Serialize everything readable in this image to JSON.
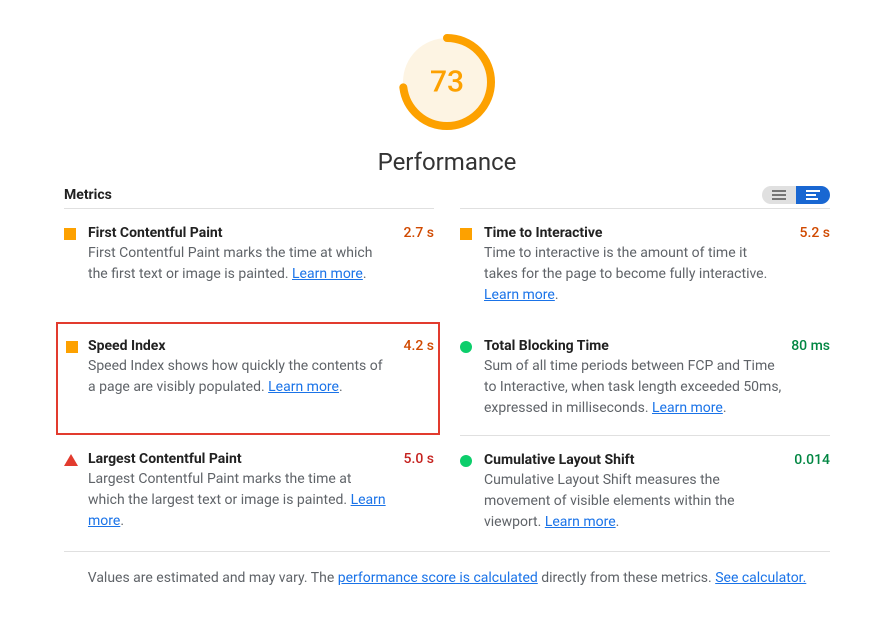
{
  "performance": {
    "score": 73,
    "title": "Performance"
  },
  "metrics_label": "Metrics",
  "metrics": [
    {
      "icon": "square",
      "name": "First Contentful Paint",
      "value": "2.7 s",
      "valueClass": "val-avg",
      "desc": "First Contentful Paint marks the time at which the first text or image is painted. ",
      "learn": "Learn more",
      "highlighted": false
    },
    {
      "icon": "square",
      "name": "Time to Interactive",
      "value": "5.2 s",
      "valueClass": "val-avg",
      "desc": "Time to interactive is the amount of time it takes for the page to become fully interactive. ",
      "learn": "Learn more",
      "highlighted": false
    },
    {
      "icon": "square",
      "name": "Speed Index",
      "value": "4.2 s",
      "valueClass": "val-avg",
      "desc": "Speed Index shows how quickly the contents of a page are visibly populated. ",
      "learn": "Learn more",
      "highlighted": true
    },
    {
      "icon": "circle",
      "name": "Total Blocking Time",
      "value": "80 ms",
      "valueClass": "val-good",
      "desc": "Sum of all time periods between FCP and Time to Interactive, when task length exceeded 50ms, expressed in milliseconds. ",
      "learn": "Learn more",
      "highlighted": false
    },
    {
      "icon": "triangle",
      "name": "Largest Contentful Paint",
      "value": "5.0 s",
      "valueClass": "val-bad",
      "desc": "Largest Contentful Paint marks the time at which the largest text or image is painted. ",
      "learn": "Learn more",
      "highlighted": false
    },
    {
      "icon": "circle",
      "name": "Cumulative Layout Shift",
      "value": "0.014",
      "valueClass": "val-good",
      "desc": "Cumulative Layout Shift measures the movement of visible elements within the viewport. ",
      "learn": "Learn more",
      "highlighted": false
    }
  ],
  "footer": {
    "pre": "Values are estimated and may vary. The ",
    "link1": "performance score is calculated",
    "mid": " directly from these metrics. ",
    "link2": "See calculator."
  }
}
